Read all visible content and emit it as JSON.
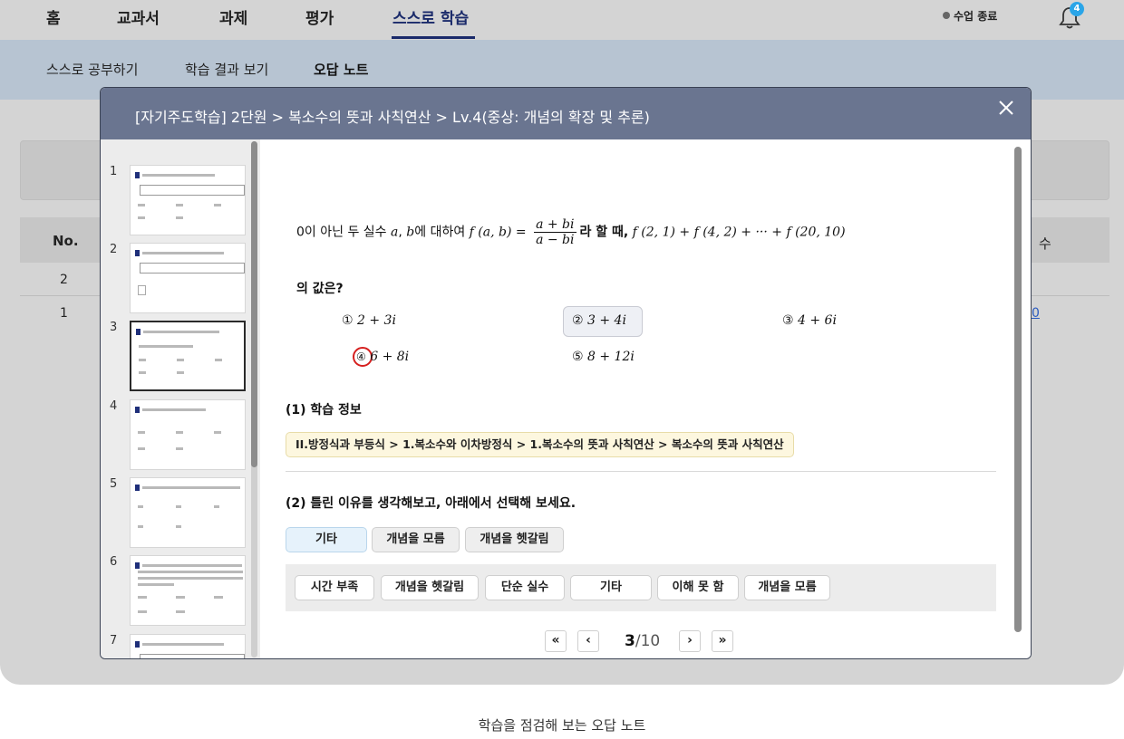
{
  "topnav": {
    "items": [
      "홈",
      "교과서",
      "과제",
      "평가",
      "스스로 학습"
    ],
    "active": "스스로 학습",
    "end_class": "수업 종료",
    "bell_count": "4"
  },
  "subnav": {
    "items": [
      "스스로 공부하기",
      "학습 결과 보기",
      "오답 노트"
    ],
    "active": "오답 노트"
  },
  "background_table": {
    "header_no": "No.",
    "header_right": "수",
    "rows": [
      "2",
      "1"
    ],
    "row1_right": "0"
  },
  "modal": {
    "title": "[자기주도학습] 2단원 > 복소수의 뜻과 사칙연산 > Lv.4(중상: 개념의 확장 및 추론)",
    "close_icon": "close-icon",
    "thumbnails": [
      "1",
      "2",
      "3",
      "4",
      "5",
      "6",
      "7"
    ],
    "selected_thumbnail": "3",
    "question": {
      "intro": "0이 아닌 두 실수",
      "var_a": "a",
      "var_b": "b",
      "mid": "에 대하여",
      "func_lhs": "f (a,  b) =",
      "frac_num": "a + bi",
      "frac_den": "a − bi",
      "tail_text": "라 할 때,",
      "expr": "f (2,  1) + f (4,  2) + ··· + f (20,  10)",
      "line2": "의 값은?"
    },
    "choices": [
      {
        "num": "①",
        "value": "2 + 3i"
      },
      {
        "num": "②",
        "value": "3 + 4i"
      },
      {
        "num": "③",
        "value": "4 + 6i"
      },
      {
        "num": "④",
        "value": "6 + 8i"
      },
      {
        "num": "⑤",
        "value": "8 + 12i"
      }
    ],
    "learning_info": {
      "title": "(1) 학습 정보",
      "path": "II.방정식과 부등식 > 1.복소수와 이차방정식 > 1.복소수의 뜻과 사칙연산 > 복소수의 뜻과 사칙연산"
    },
    "reason": {
      "title": "(2) 틀린 이유를 생각해보고, 아래에서 선택해 보세요.",
      "selected": [
        "기타",
        "개념을 모름",
        "개념을 헷갈림"
      ],
      "options": [
        "시간 부족",
        "개념을 헷갈림",
        "단순 실수",
        "기타",
        "이해 못 함",
        "개념을 모름"
      ]
    },
    "pager": {
      "first": "«",
      "prev": "‹",
      "current": "3",
      "total": "/10",
      "next": "›",
      "last": "»"
    }
  },
  "caption": "학습을 점검해 보는 오답 노트"
}
